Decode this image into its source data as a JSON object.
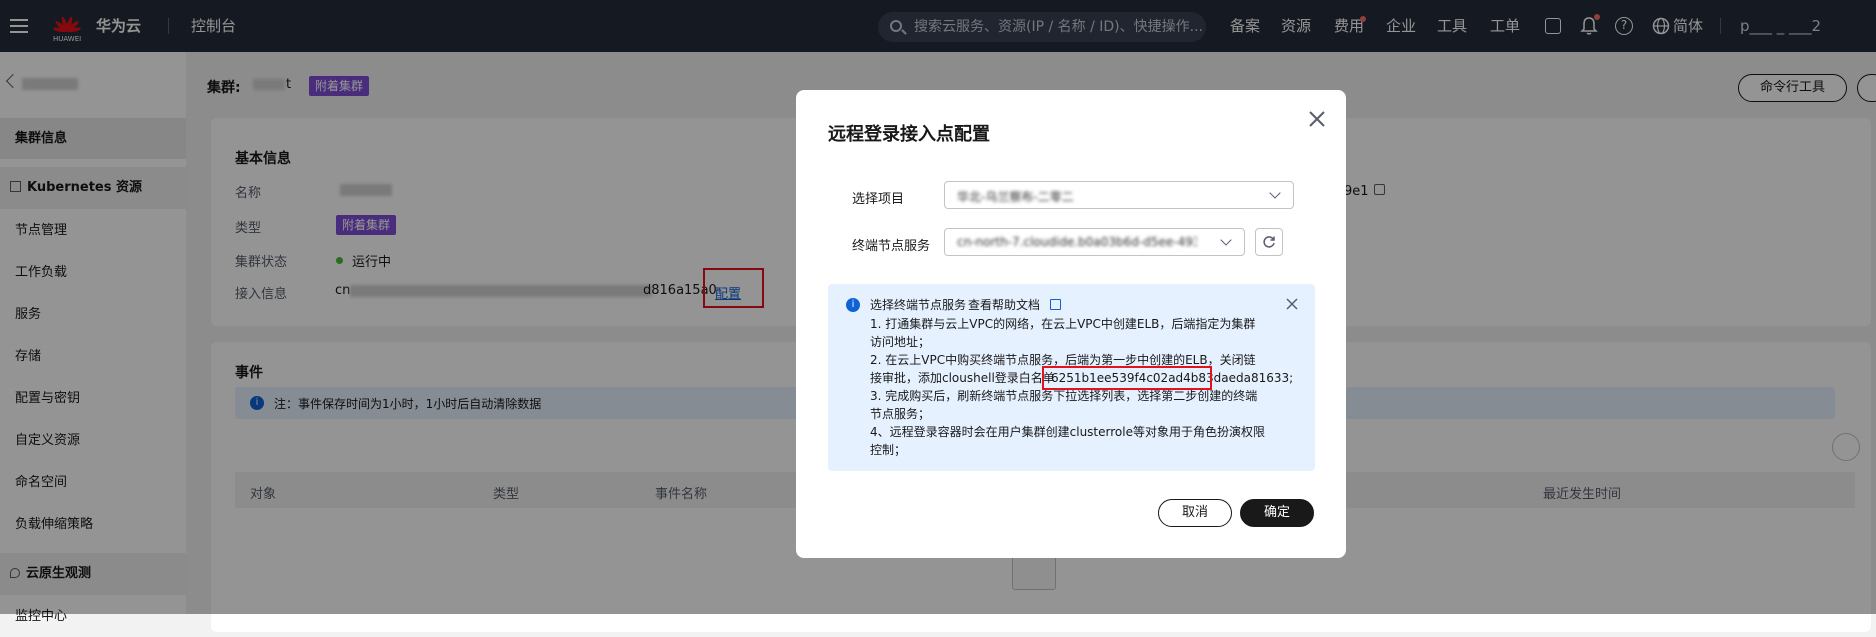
{
  "topbar": {
    "brand_logo": "HUAWEI",
    "brand": "华为云",
    "console": "控制台",
    "search_placeholder": "搜索云服务、资源(IP / 名称 / ID)、快捷操作...",
    "nav": [
      "备案",
      "资源",
      "费用",
      "企业",
      "工具",
      "工单"
    ],
    "language": "简体",
    "user": "p___ _ ___2"
  },
  "sidebar": {
    "back_label": "",
    "items": [
      {
        "label": "集群信息",
        "selected": true
      },
      {
        "label": "Kubernetes 资源",
        "group": true,
        "icon": "grid-icon"
      },
      {
        "label": "节点管理"
      },
      {
        "label": "工作负载"
      },
      {
        "label": "服务"
      },
      {
        "label": "存储"
      },
      {
        "label": "配置与密钥"
      },
      {
        "label": "自定义资源"
      },
      {
        "label": "命名空间"
      },
      {
        "label": "负载伸缩策略"
      },
      {
        "label": "云原生观测",
        "group": true,
        "icon": "wrench-icon"
      },
      {
        "label": "监控中心"
      }
    ]
  },
  "header": {
    "cluster_label": "集群:",
    "cluster_name_suffix": "t",
    "cluster_tag": "附着集群",
    "cli_button": "命令行工具"
  },
  "basic_info": {
    "title": "基本信息",
    "rows": [
      {
        "label": "名称",
        "value": ""
      },
      {
        "label": "类型",
        "value": "附着集群"
      },
      {
        "label": "集群状态",
        "value": "运行中"
      },
      {
        "label": "接入信息",
        "value_prefix": "cn",
        "value_suffix": "d816a15a0",
        "action": "配置"
      }
    ],
    "right_id_fragment": "9e1"
  },
  "events": {
    "title": "事件",
    "notice": "注：事件保存时间为1小时，1小时后自动清除数据",
    "columns": [
      "对象",
      "类型",
      "事件名称",
      "最近发生时间"
    ]
  },
  "dialog": {
    "title": "远程登录接入点配置",
    "project_label": "选择项目",
    "project_value": "华北-乌兰察布-二零二",
    "endpoint_label": "终端节点服务",
    "endpoint_value": "cn-north-7.cloudide.b0a03b6d-d5ee-4932-9...",
    "info_title": "选择终端节点服务",
    "help_link": "查看帮助文档",
    "info_lines": [
      "1. 打通集群与云上VPC的网络，在云上VPC中创建ELB，后端指定为集群",
      "访问地址；",
      "2. 在云上VPC中购买终端节点服务，后端为第一步中创建的ELB，关闭链",
      "接审批，添加cloushell登录白名单",
      "3. 完成购买后，刷新终端节点服务下拉选择列表，选择第二步创建的终端",
      "节点服务；",
      "4、远程登录容器时会在用户集群创建clusterrole等对象用于角色扮演权限",
      "控制；"
    ],
    "whitelist_id": "6251b1ee539f4c02ad4b83daeda81633;",
    "cancel": "取消",
    "confirm": "确定"
  },
  "colors": {
    "topbar": "#252b3a",
    "tag": "#7f4fd6",
    "primary_button": "#191919",
    "link": "#0e62d6",
    "highlight": "#e3121b",
    "info_bg": "#e6f1ff",
    "status_running": "#50b83c"
  }
}
